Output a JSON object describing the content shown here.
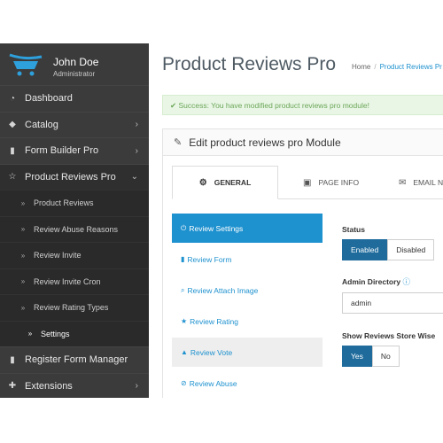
{
  "profile": {
    "name": "John Doe",
    "role": "Administrator"
  },
  "sidebar": {
    "items": [
      {
        "icon": "dashboard-icon",
        "glyph": "◔",
        "label": "Dashboard",
        "chevron": ""
      },
      {
        "icon": "tag-icon",
        "glyph": "◆",
        "label": "Catalog",
        "chevron": "›"
      },
      {
        "icon": "file-icon",
        "glyph": "▮",
        "label": "Form Builder Pro",
        "chevron": "›"
      },
      {
        "icon": "star-icon",
        "glyph": "☆",
        "label": "Product Reviews Pro",
        "chevron": "⌄"
      }
    ],
    "subitems": [
      {
        "label": "Product Reviews",
        "glyph": "»"
      },
      {
        "label": "Review Abuse Reasons",
        "glyph": "»"
      },
      {
        "label": "Review Invite",
        "glyph": "»"
      },
      {
        "label": "Review Invite Cron",
        "glyph": "»"
      },
      {
        "label": "Review Rating Types",
        "glyph": "»"
      },
      {
        "label": "Settings",
        "glyph": "»"
      }
    ],
    "items_after": [
      {
        "icon": "file-icon",
        "glyph": "▮",
        "label": "Register Form Manager",
        "chevron": ""
      },
      {
        "icon": "puzzle-icon",
        "glyph": "✚",
        "label": "Extensions",
        "chevron": "›"
      }
    ]
  },
  "header": {
    "title": "Product Reviews Pro",
    "breadcrumb": {
      "home": "Home",
      "separator": "/",
      "current": "Product Reviews Pr"
    }
  },
  "alert": {
    "icon": "check-circle-icon",
    "text": "Success: You have modified product reviews pro module!"
  },
  "panel": {
    "icon": "pencil-icon",
    "title": "Edit product reviews pro Module"
  },
  "tabs": [
    {
      "icon": "gears-icon",
      "glyph": "⚙",
      "label": "GENERAL"
    },
    {
      "icon": "image-icon",
      "glyph": "▣",
      "label": "PAGE INFO"
    },
    {
      "icon": "envelope-icon",
      "glyph": "✉",
      "label": "EMAIL N"
    }
  ],
  "vtabs": [
    {
      "icon": "power-icon",
      "glyph": "⏻",
      "label": "Review Settings"
    },
    {
      "icon": "file-icon",
      "glyph": "▮",
      "label": "Review Form"
    },
    {
      "icon": "paperclip-icon",
      "glyph": "⌕",
      "label": "Review Attach Image"
    },
    {
      "icon": "star-icon",
      "glyph": "★",
      "label": "Review Rating"
    },
    {
      "icon": "thumbs-up-icon",
      "glyph": "▲",
      "label": "Review Vote"
    },
    {
      "icon": "ban-icon",
      "glyph": "⊘",
      "label": "Review Abuse"
    }
  ],
  "form": {
    "status": {
      "label": "Status",
      "on": "Enabled",
      "off": "Disabled"
    },
    "admin_directory": {
      "label": "Admin Directory",
      "help_glyph": "?",
      "value": "admin"
    },
    "store_wise": {
      "label": "Show Reviews Store Wise",
      "on": "Yes",
      "off": "No"
    }
  },
  "colors": {
    "sidebar": "#3b3b3b",
    "accent": "#1e91cf",
    "active_button": "#1e6b9c",
    "success_bg": "#e9f6e6"
  }
}
